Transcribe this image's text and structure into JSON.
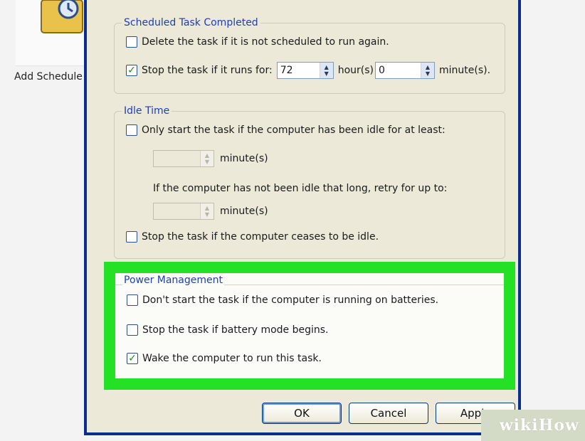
{
  "background": {
    "add_label": "Add Schedule"
  },
  "scheduled_task": {
    "title": "Scheduled Task Completed",
    "delete_label": "Delete the task if it is not scheduled to run again.",
    "delete_checked": false,
    "stop_label": "Stop the task if it runs for:",
    "stop_checked": true,
    "hours_value": "72",
    "hours_unit": "hour(s)",
    "minutes_value": "0",
    "minutes_unit": "minute(s)."
  },
  "idle_time": {
    "title": "Idle Time",
    "only_start_label": "Only start the task if the computer has been idle for at least:",
    "only_start_checked": false,
    "idle_minutes_unit": "minute(s)",
    "retry_text": "If the computer has not been idle that long, retry for up to:",
    "retry_minutes_unit": "minute(s)",
    "stop_idle_label": "Stop the task if the computer ceases to be idle.",
    "stop_idle_checked": false
  },
  "power_management": {
    "title": "Power Management",
    "batteries_label": "Don't start the task if the computer is running on batteries.",
    "batteries_checked": false,
    "battery_mode_label": "Stop the task if battery mode begins.",
    "battery_mode_checked": false,
    "wake_label": "Wake the computer to run this task.",
    "wake_checked": true,
    "highlight_color": "#25e125"
  },
  "buttons": {
    "ok": "OK",
    "cancel": "Cancel",
    "apply": "Apply"
  },
  "watermark": {
    "wiki": "wiki",
    "how": "How"
  },
  "colors": {
    "dialog_border": "#0a2e8a",
    "dialog_bg": "#ece9d8",
    "group_title": "#1c3fb5"
  }
}
